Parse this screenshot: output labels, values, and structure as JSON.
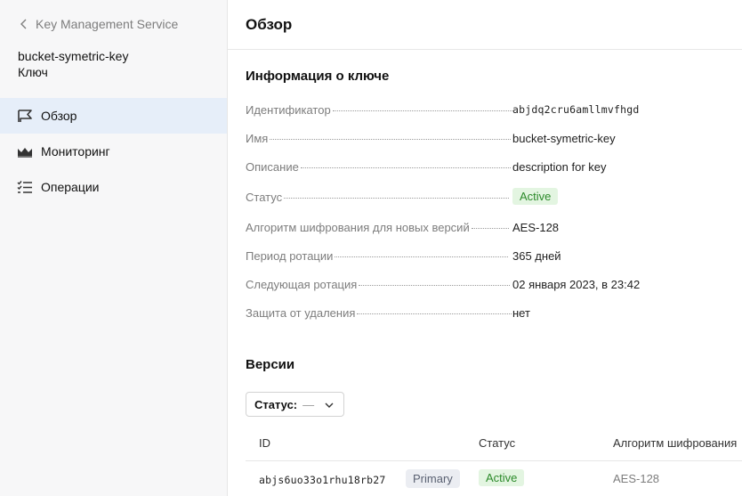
{
  "sidebar": {
    "back_label": "Key Management Service",
    "resource_name": "bucket-symetric-key",
    "resource_type": "Ключ",
    "nav": [
      {
        "label": "Обзор",
        "icon": "flag-icon",
        "active": true
      },
      {
        "label": "Мониторинг",
        "icon": "chart-icon",
        "active": false
      },
      {
        "label": "Операции",
        "icon": "list-check-icon",
        "active": false
      }
    ]
  },
  "header": {
    "title": "Обзор"
  },
  "info": {
    "title": "Информация о ключе",
    "rows": [
      {
        "label": "Идентификатор",
        "value": "abjdq2cru6amllmvfhgd"
      },
      {
        "label": "Имя",
        "value": "bucket-symetric-key"
      },
      {
        "label": "Описание",
        "value": "description for key"
      },
      {
        "label": "Статус",
        "value": "Active"
      },
      {
        "label": "Алгоритм шифрования для новых версий",
        "value": "AES-128"
      },
      {
        "label": "Период ротации",
        "value": "365 дней"
      },
      {
        "label": "Следующая ротация",
        "value": "02 января 2023, в 23:42"
      },
      {
        "label": "Защита от удаления",
        "value": "нет"
      }
    ]
  },
  "versions": {
    "title": "Версии",
    "filter_label": "Статус:",
    "filter_value": "—",
    "columns": [
      "ID",
      "Статус",
      "Алгоритм шифрования"
    ],
    "rows": [
      {
        "id": "abjs6uo33o1rhu18rb27",
        "tag": "Primary",
        "status": "Active",
        "algorithm": "AES-128"
      }
    ]
  },
  "colors": {
    "active_nav_bg": "#e6eef9",
    "badge_active_bg": "#e3f5e1",
    "badge_active_text": "#2c8a2a"
  }
}
